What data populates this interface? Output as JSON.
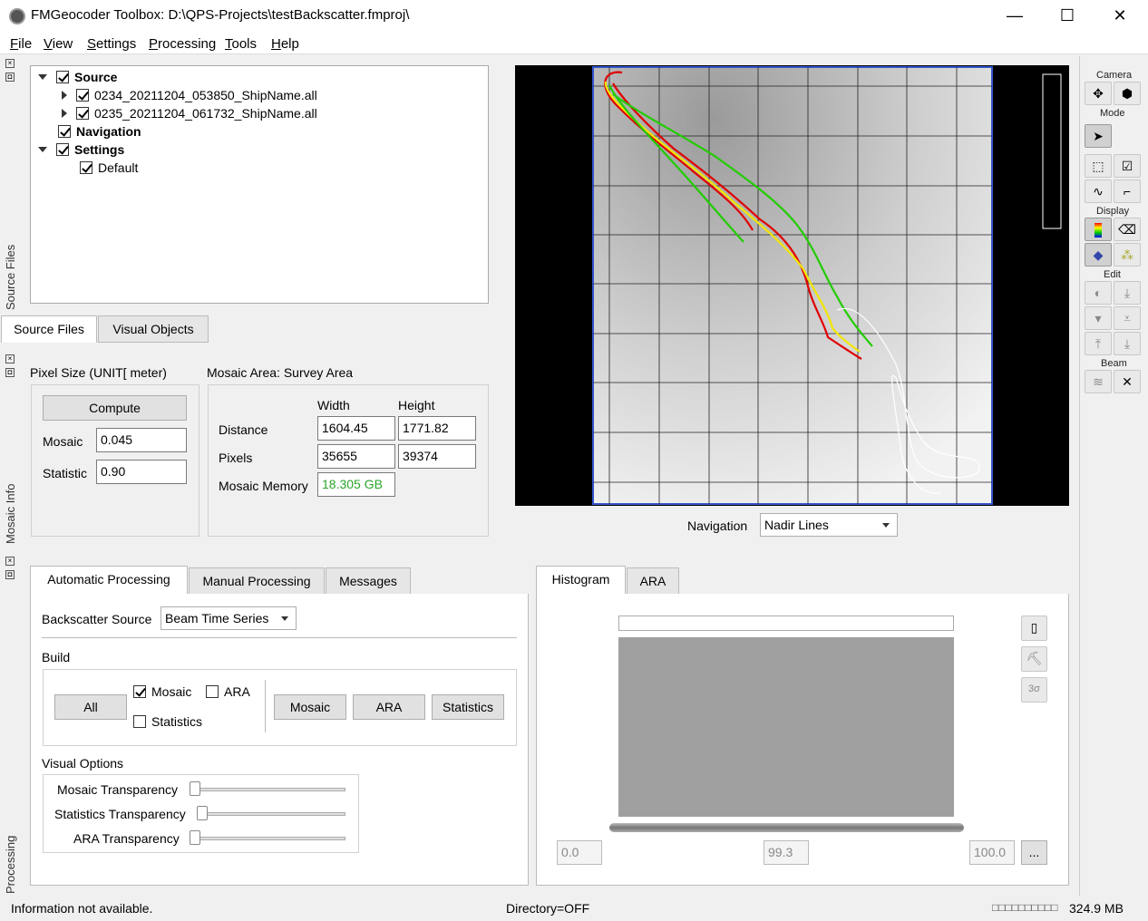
{
  "title": "FMGeocoder Toolbox: D:\\QPS-Projects\\testBackscatter.fmproj\\",
  "window_controls": {
    "minimize": "—",
    "maximize": "☐",
    "close": "✕"
  },
  "menu": [
    "File",
    "View",
    "Settings",
    "Processing",
    "Tools",
    "Help"
  ],
  "side_labels": {
    "source_files": "Source Files",
    "mosaic_info": "Mosaic Info",
    "processing": "Processing"
  },
  "tree": {
    "source": "Source",
    "file1": "0234_20211204_053850_ShipName.all",
    "file2": "0235_20211204_061732_ShipName.all",
    "navigation": "Navigation",
    "settings": "Settings",
    "default": "Default"
  },
  "source_tabs": [
    "Source Files",
    "Visual Objects"
  ],
  "mosaic_info": {
    "pixel_size_label": "Pixel Size (UNIT[ meter)",
    "compute": "Compute",
    "mosaic_label": "Mosaic",
    "mosaic_value": "0.045",
    "statistic_label": "Statistic",
    "statistic_value": "0.90",
    "area_label": "Mosaic Area:  Survey Area",
    "width": "Width",
    "height": "Height",
    "distance": "Distance",
    "distance_w": "1604.45",
    "distance_h": "1771.82",
    "pixels": "Pixels",
    "pixels_w": "35655",
    "pixels_h": "39374",
    "memory_label": "Mosaic Memory",
    "memory_value": "18.305 GB"
  },
  "navigation": {
    "label": "Navigation",
    "value": "Nadir Lines"
  },
  "processing_tabs": [
    "Automatic Processing",
    "Manual Processing",
    "Messages"
  ],
  "processing": {
    "backscatter_source_label": "Backscatter Source",
    "backscatter_source_value": "Beam Time Series",
    "build_label": "Build",
    "all": "All",
    "mosaic_cb": "Mosaic",
    "ara_cb": "ARA",
    "statistics_cb": "Statistics",
    "mosaic_btn": "Mosaic",
    "ara_btn": "ARA",
    "statistics_btn": "Statistics",
    "visual_options": "Visual Options",
    "mosaic_transparency": "Mosaic Transparency",
    "statistics_transparency": "Statistics Transparency",
    "ara_transparency": "ARA Transparency"
  },
  "histogram_tabs": [
    "Histogram",
    "ARA"
  ],
  "histogram": {
    "min": "0.0",
    "mid": "99.3",
    "max": "100.0",
    "more": "...",
    "sigma": "3σ"
  },
  "toolbar": {
    "camera": "Camera",
    "mode": "Mode",
    "display": "Display",
    "edit": "Edit",
    "beam": "Beam"
  },
  "status": {
    "info": "Information not available.",
    "directory": "Directory=OFF",
    "memory_codes": "□□□□□□□□□□",
    "memory": "324.9 MB"
  },
  "colors": {
    "track_red": "#e00000",
    "track_green": "#22cc00",
    "track_yellow": "#f2e600",
    "track_white": "#ffffff",
    "memory_green": "#2aa52a"
  }
}
